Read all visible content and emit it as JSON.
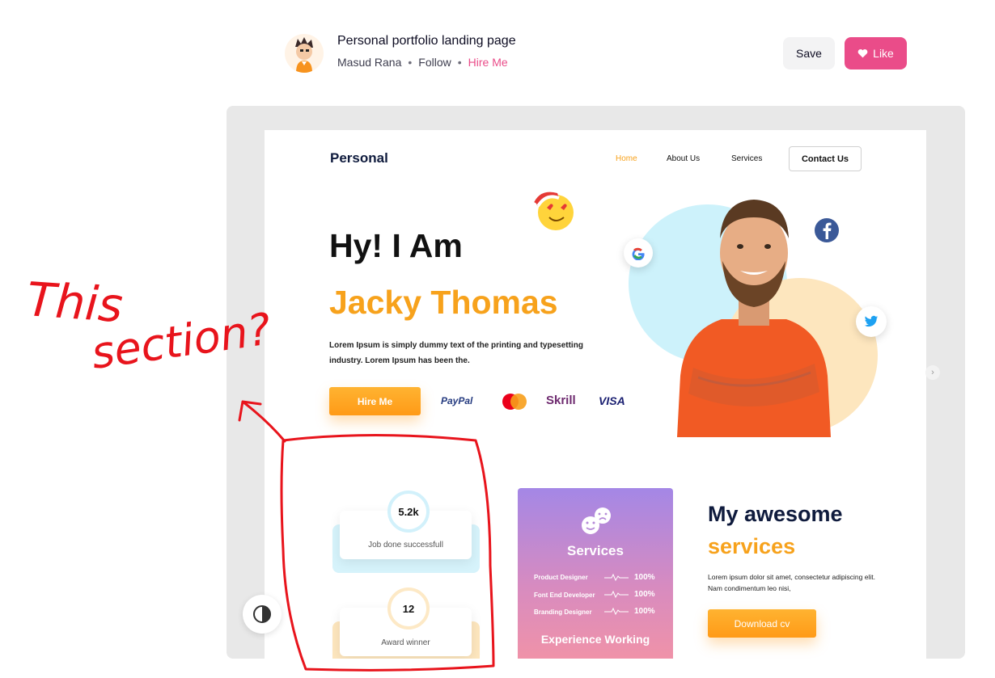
{
  "header": {
    "title": "Personal portfolio landing page",
    "author": "Masud Rana",
    "follow": "Follow",
    "hire": "Hire Me",
    "dot": "•",
    "save_label": "Save",
    "like_label": "Like",
    "accent_color": "#ea4c89"
  },
  "shot": {
    "logo": "Personal",
    "nav": [
      "Home",
      "About Us",
      "Services"
    ],
    "contact_label": "Contact Us",
    "hero_line1": "Hy! I Am",
    "hero_line2": "Jacky Thomas",
    "lorem": "Lorem Ipsum is simply dummy text of the printing and typesetting industry. Lorem Ipsum has been the.",
    "hire_label": "Hire Me",
    "payments": {
      "paypal": "PayPal",
      "mastercard": "MasterCard",
      "skrill": "Skrill",
      "visa": "VISA"
    },
    "stats": [
      {
        "value": "5.2k",
        "label": "Job done successfull"
      },
      {
        "value": "12",
        "label": "Award winner"
      }
    ],
    "services_card": {
      "title": "Services",
      "rows": [
        {
          "label": "Product Designer",
          "value": "100%"
        },
        {
          "label": "Font End Developer",
          "value": "100%"
        },
        {
          "label": "Branding Designer",
          "value": "100%"
        }
      ],
      "footer": "Experience Working"
    },
    "my_awesome": "My awesome",
    "services_word": "services",
    "services_desc": "Lorem ipsum dolor sit amet, consectetur adipiscing elit. Nam condimentum leo nisi,",
    "download_label": "Download cv",
    "accent_color": "#f7a21c"
  },
  "annotation": {
    "line1": "This",
    "line2": "section?",
    "color": "#e8141c"
  },
  "icons": [
    "avatar",
    "heart-icon",
    "google-icon",
    "facebook-icon",
    "twitter-icon",
    "emoji-icon",
    "contrast-icon",
    "chevron-right-icon"
  ]
}
